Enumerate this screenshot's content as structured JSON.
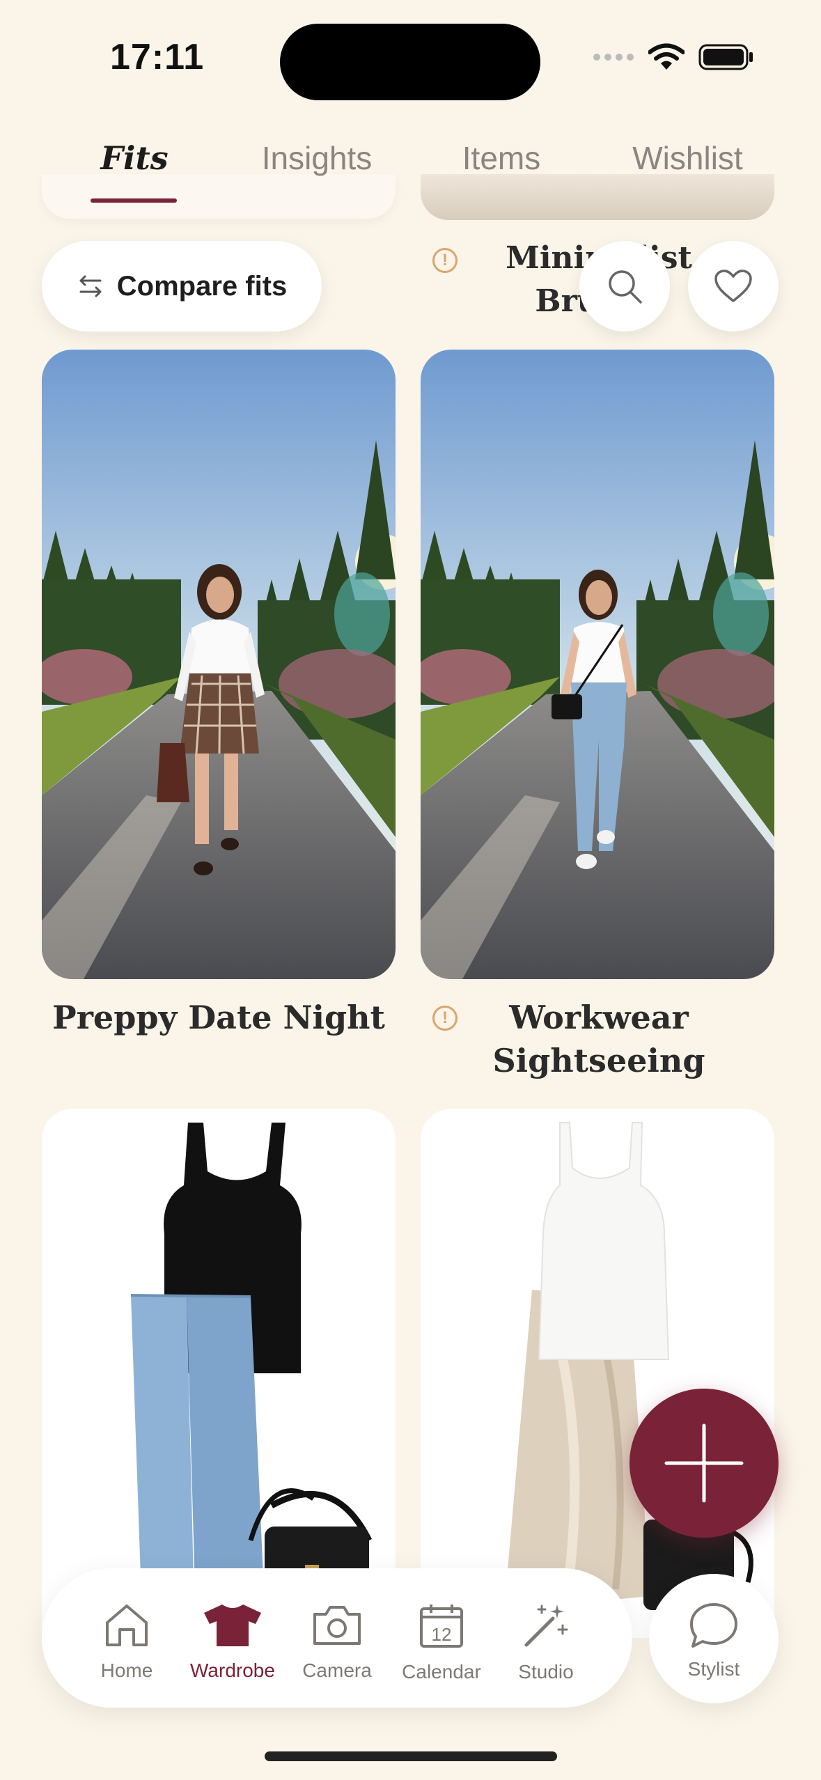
{
  "status_bar": {
    "time": "17:11"
  },
  "tabs": [
    {
      "label": "Fits",
      "active": true
    },
    {
      "label": "Insights",
      "active": false
    },
    {
      "label": "Items",
      "active": false
    },
    {
      "label": "Wishlist",
      "active": false
    }
  ],
  "toolbar": {
    "compare_label": "Compare fits"
  },
  "fits": [
    {
      "title_line1": "Minimalist",
      "title_line2": "Brunch",
      "warning": true
    },
    {
      "title_line1": "Preppy  Date Night",
      "title_line2": "",
      "warning": false
    },
    {
      "title_line1": "Workwear",
      "title_line2": "Sightseeing",
      "warning": true
    }
  ],
  "nav": {
    "items": [
      {
        "label": "Home",
        "icon": "home-icon",
        "active": false
      },
      {
        "label": "Wardrobe",
        "icon": "shirt-icon",
        "active": true
      },
      {
        "label": "Camera",
        "icon": "camera-icon",
        "active": false
      },
      {
        "label": "Calendar",
        "icon": "calendar-icon",
        "active": false,
        "day": "12"
      },
      {
        "label": "Studio",
        "icon": "magic-wand-icon",
        "active": false
      }
    ],
    "stylist_label": "Stylist"
  },
  "colors": {
    "accent": "#7A2237",
    "background": "#FAF4E9",
    "warning": "#D9A56E"
  }
}
